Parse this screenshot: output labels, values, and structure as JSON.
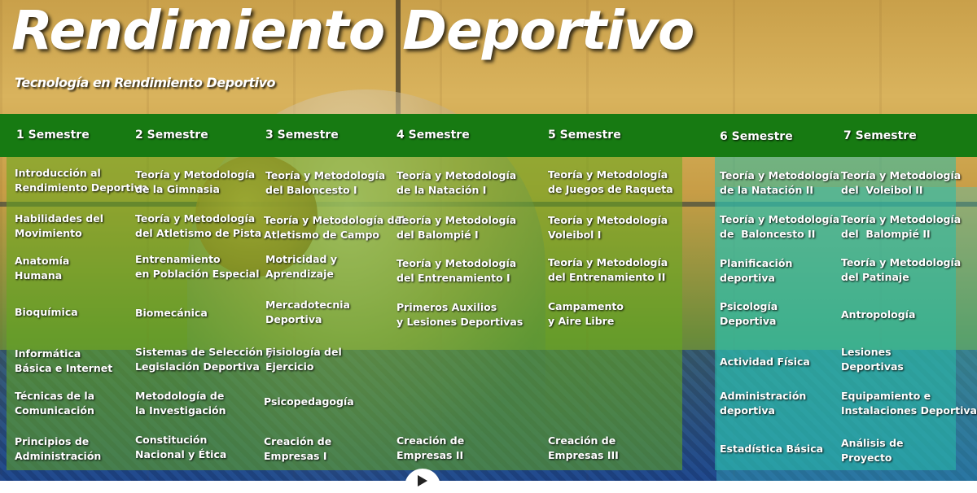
{
  "header": {
    "title": "Rendimiento Deportivo",
    "subtitle": "Tecnología en Rendimiento Deportivo"
  },
  "semesters": [
    {
      "label": "1 Semestre",
      "courses": [
        "Introducción al\nRendimiento Deportivo",
        "Habilidades del\nMovimiento",
        "Anatomía\nHumana",
        "Bioquímica",
        "Informática\nBásica e Internet",
        "Técnicas de la\nComunicación",
        "Principios de\nAdministración"
      ]
    },
    {
      "label": "2 Semestre",
      "courses": [
        "Teoría y Metodología\nde la Gimnasia",
        "Teoría y Metodología\ndel Atletismo de Pista",
        "Entrenamiento\nen Población Especial",
        "Biomecánica",
        "Sistemas de Selección y\nLegislación Deportiva",
        "Metodología de\nla Investigación",
        "Constitución\nNacional y Ética"
      ]
    },
    {
      "label": "3 Semestre",
      "courses": [
        "Teoría y Metodología\ndel Baloncesto I",
        "Teoría y Metodología del\nAtletismo de Campo",
        "Motricidad y\nAprendizaje",
        "Mercadotecnia\nDeportiva",
        "Fisiología del\nEjercicio",
        "Psicopedagogía",
        "Creación de\nEmpresas I"
      ]
    },
    {
      "label": "4 Semestre",
      "courses": [
        "Teoría y Metodología\nde la Natación I",
        "Teoría y Metodología\ndel Balompié I",
        "Teoría y Metodología\ndel Entrenamiento I",
        "Primeros Auxilios\ny Lesiones Deportivas",
        "Creación de\nEmpresas II"
      ]
    },
    {
      "label": "5 Semestre",
      "courses": [
        "Teoría y Metodología\nde Juegos de Raqueta",
        "Teoría y Metodología\nVoleibol I",
        "Teoría y Metodología\ndel Entrenamiento II",
        "Campamento\ny Aire Libre",
        "Creación de\nEmpresas III"
      ]
    },
    {
      "label": "6 Semestre",
      "courses": [
        "Teoría y Metodología\nde la Natación II",
        "Teoría y Metodología\nde  Baloncesto II",
        "Planificación\ndeportiva",
        "Psicología\nDeportiva",
        "Actividad Física",
        "Administración\ndeportiva",
        "Estadística Básica"
      ]
    },
    {
      "label": "7 Semestre",
      "courses": [
        "Teoría y Metodología\ndel  Voleibol II",
        "Teoría y Metodología\ndel  Balompié II",
        "Teoría y Metodología\ndel Patinaje",
        "Antropología",
        "Lesiones\nDeportivas",
        "Equipamiento e\nInstalaciones Deportivas",
        "Análisis de\nProyecto"
      ]
    }
  ]
}
